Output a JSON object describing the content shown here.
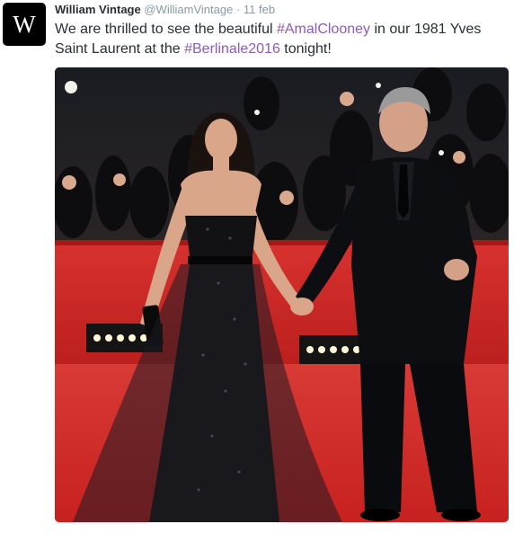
{
  "tweet": {
    "avatar_letter": "W",
    "fullname": "William Vintage",
    "username": "@WilliamVintage",
    "separator": "·",
    "timestamp": "11 feb",
    "text_part1": "We are thrilled to see the beautiful ",
    "hashtag1": "#AmalClooney",
    "text_part2": " in our 1981 Yves Saint Laurent at the ",
    "hashtag2": "#Berlinale2016",
    "text_part3": " tonight!",
    "colors": {
      "text": "#292f33",
      "muted": "#8899a6",
      "hashtag": "#8b5cb7",
      "avatar_bg": "#000000"
    }
  }
}
